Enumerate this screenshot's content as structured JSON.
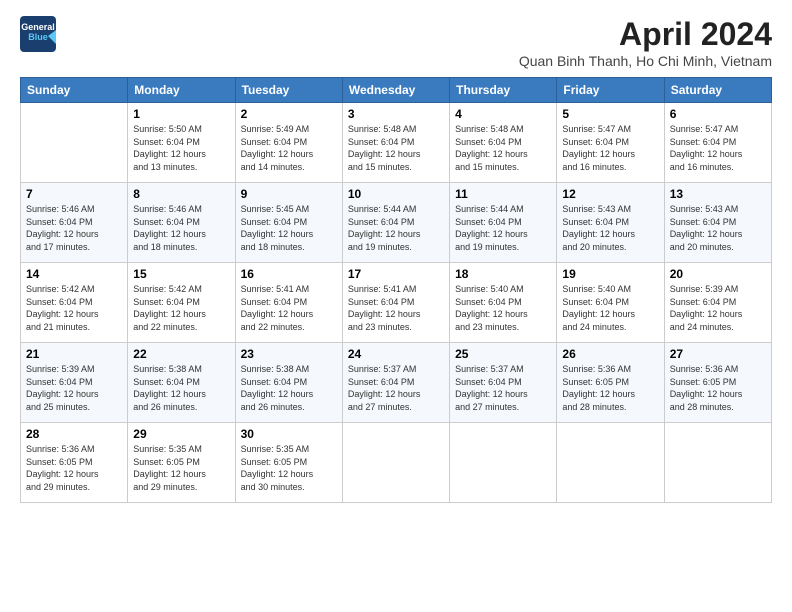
{
  "header": {
    "logo_line1": "General",
    "logo_line2": "Blue",
    "title": "April 2024",
    "location": "Quan Binh Thanh, Ho Chi Minh, Vietnam"
  },
  "days_of_week": [
    "Sunday",
    "Monday",
    "Tuesday",
    "Wednesday",
    "Thursday",
    "Friday",
    "Saturday"
  ],
  "weeks": [
    [
      {
        "day": "",
        "info": ""
      },
      {
        "day": "1",
        "info": "Sunrise: 5:50 AM\nSunset: 6:04 PM\nDaylight: 12 hours\nand 13 minutes."
      },
      {
        "day": "2",
        "info": "Sunrise: 5:49 AM\nSunset: 6:04 PM\nDaylight: 12 hours\nand 14 minutes."
      },
      {
        "day": "3",
        "info": "Sunrise: 5:48 AM\nSunset: 6:04 PM\nDaylight: 12 hours\nand 15 minutes."
      },
      {
        "day": "4",
        "info": "Sunrise: 5:48 AM\nSunset: 6:04 PM\nDaylight: 12 hours\nand 15 minutes."
      },
      {
        "day": "5",
        "info": "Sunrise: 5:47 AM\nSunset: 6:04 PM\nDaylight: 12 hours\nand 16 minutes."
      },
      {
        "day": "6",
        "info": "Sunrise: 5:47 AM\nSunset: 6:04 PM\nDaylight: 12 hours\nand 16 minutes."
      }
    ],
    [
      {
        "day": "7",
        "info": "Sunrise: 5:46 AM\nSunset: 6:04 PM\nDaylight: 12 hours\nand 17 minutes."
      },
      {
        "day": "8",
        "info": "Sunrise: 5:46 AM\nSunset: 6:04 PM\nDaylight: 12 hours\nand 18 minutes."
      },
      {
        "day": "9",
        "info": "Sunrise: 5:45 AM\nSunset: 6:04 PM\nDaylight: 12 hours\nand 18 minutes."
      },
      {
        "day": "10",
        "info": "Sunrise: 5:44 AM\nSunset: 6:04 PM\nDaylight: 12 hours\nand 19 minutes."
      },
      {
        "day": "11",
        "info": "Sunrise: 5:44 AM\nSunset: 6:04 PM\nDaylight: 12 hours\nand 19 minutes."
      },
      {
        "day": "12",
        "info": "Sunrise: 5:43 AM\nSunset: 6:04 PM\nDaylight: 12 hours\nand 20 minutes."
      },
      {
        "day": "13",
        "info": "Sunrise: 5:43 AM\nSunset: 6:04 PM\nDaylight: 12 hours\nand 20 minutes."
      }
    ],
    [
      {
        "day": "14",
        "info": "Sunrise: 5:42 AM\nSunset: 6:04 PM\nDaylight: 12 hours\nand 21 minutes."
      },
      {
        "day": "15",
        "info": "Sunrise: 5:42 AM\nSunset: 6:04 PM\nDaylight: 12 hours\nand 22 minutes."
      },
      {
        "day": "16",
        "info": "Sunrise: 5:41 AM\nSunset: 6:04 PM\nDaylight: 12 hours\nand 22 minutes."
      },
      {
        "day": "17",
        "info": "Sunrise: 5:41 AM\nSunset: 6:04 PM\nDaylight: 12 hours\nand 23 minutes."
      },
      {
        "day": "18",
        "info": "Sunrise: 5:40 AM\nSunset: 6:04 PM\nDaylight: 12 hours\nand 23 minutes."
      },
      {
        "day": "19",
        "info": "Sunrise: 5:40 AM\nSunset: 6:04 PM\nDaylight: 12 hours\nand 24 minutes."
      },
      {
        "day": "20",
        "info": "Sunrise: 5:39 AM\nSunset: 6:04 PM\nDaylight: 12 hours\nand 24 minutes."
      }
    ],
    [
      {
        "day": "21",
        "info": "Sunrise: 5:39 AM\nSunset: 6:04 PM\nDaylight: 12 hours\nand 25 minutes."
      },
      {
        "day": "22",
        "info": "Sunrise: 5:38 AM\nSunset: 6:04 PM\nDaylight: 12 hours\nand 26 minutes."
      },
      {
        "day": "23",
        "info": "Sunrise: 5:38 AM\nSunset: 6:04 PM\nDaylight: 12 hours\nand 26 minutes."
      },
      {
        "day": "24",
        "info": "Sunrise: 5:37 AM\nSunset: 6:04 PM\nDaylight: 12 hours\nand 27 minutes."
      },
      {
        "day": "25",
        "info": "Sunrise: 5:37 AM\nSunset: 6:04 PM\nDaylight: 12 hours\nand 27 minutes."
      },
      {
        "day": "26",
        "info": "Sunrise: 5:36 AM\nSunset: 6:05 PM\nDaylight: 12 hours\nand 28 minutes."
      },
      {
        "day": "27",
        "info": "Sunrise: 5:36 AM\nSunset: 6:05 PM\nDaylight: 12 hours\nand 28 minutes."
      }
    ],
    [
      {
        "day": "28",
        "info": "Sunrise: 5:36 AM\nSunset: 6:05 PM\nDaylight: 12 hours\nand 29 minutes."
      },
      {
        "day": "29",
        "info": "Sunrise: 5:35 AM\nSunset: 6:05 PM\nDaylight: 12 hours\nand 29 minutes."
      },
      {
        "day": "30",
        "info": "Sunrise: 5:35 AM\nSunset: 6:05 PM\nDaylight: 12 hours\nand 30 minutes."
      },
      {
        "day": "",
        "info": ""
      },
      {
        "day": "",
        "info": ""
      },
      {
        "day": "",
        "info": ""
      },
      {
        "day": "",
        "info": ""
      }
    ]
  ]
}
